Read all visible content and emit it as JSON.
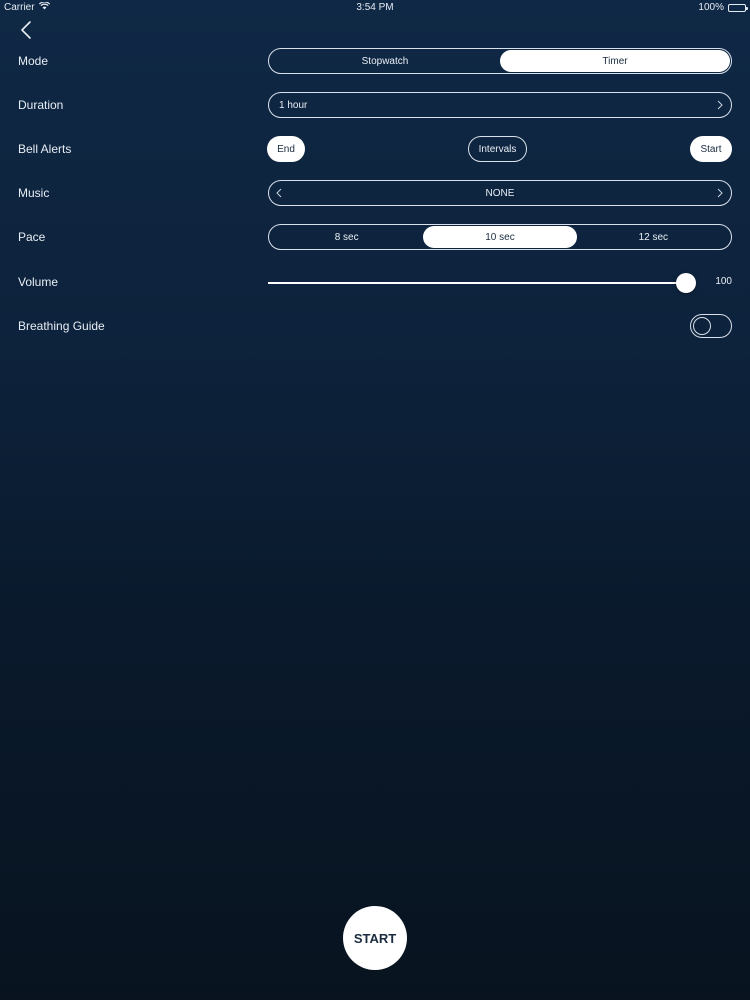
{
  "status_bar": {
    "carrier": "Carrier",
    "time": "3:54 PM",
    "battery": "100%"
  },
  "nav": {
    "back_icon": "chevron-left-icon"
  },
  "settings": {
    "mode": {
      "label": "Mode",
      "options": [
        "Stopwatch",
        "Timer"
      ],
      "selected": "Timer"
    },
    "duration": {
      "label": "Duration",
      "value": "1 hour"
    },
    "bell_alerts": {
      "label": "Bell Alerts",
      "end": "End",
      "intervals": "Intervals",
      "start": "Start"
    },
    "music": {
      "label": "Music",
      "value": "NONE"
    },
    "pace": {
      "label": "Pace",
      "options": [
        "8 sec",
        "10 sec",
        "12 sec"
      ],
      "selected": "10 sec"
    },
    "volume": {
      "label": "Volume",
      "value": "100",
      "level": 100
    },
    "breathing_guide": {
      "label": "Breathing Guide",
      "enabled": false
    }
  },
  "start_button": {
    "label": "START"
  }
}
